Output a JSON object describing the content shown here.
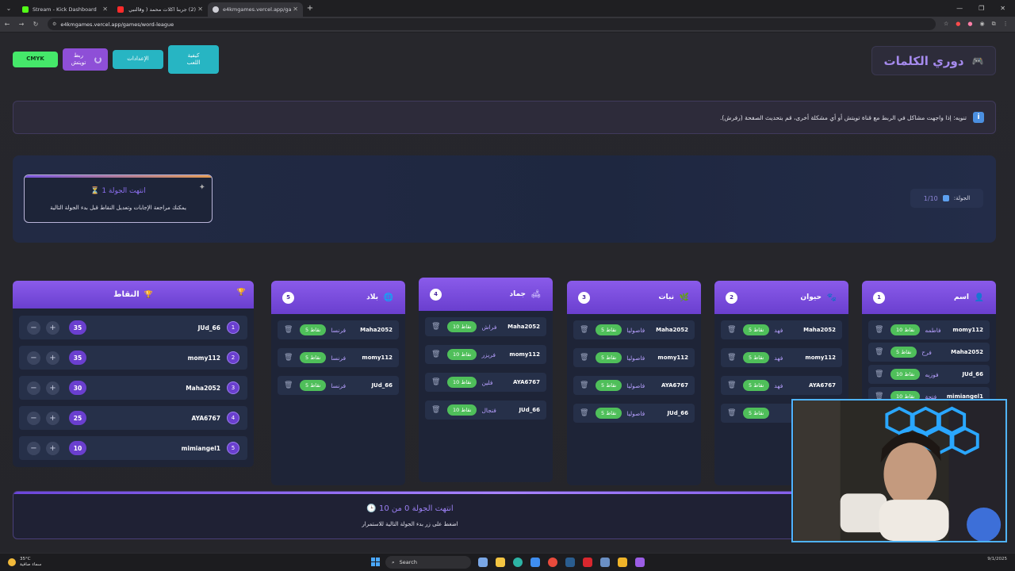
{
  "browser": {
    "tabs": [
      {
        "title": "Stream - Kick Dashboard",
        "fav_color": "#53fc18",
        "active": false
      },
      {
        "title": "(2) جربنا اكلات محمد ( وقالنبي ج...",
        "fav_color": "#ff2b2b",
        "active": false
      },
      {
        "title": "e4kmgames.vercel.app/games/...",
        "fav_color": "#cfcfd6",
        "active": true
      }
    ],
    "url": "e4kmgames.vercel.app/games/word-league"
  },
  "header": {
    "logo_title": "دوري الكلمات",
    "buttons": {
      "cmyk": "CMYK",
      "twitch": "ربط تويتش",
      "settings": "الإعدادات",
      "how_to_play": "كيفية اللعب"
    }
  },
  "notice": {
    "icon": "i",
    "text": "تنويه: إذا واجهت مشاكل في الربط مع قناة تويتش أو أي مشكلة أخرى، قم بتحديث الصفحة (رفرش)."
  },
  "status": {
    "round_ended_title": "انتهت الجولة 1 ⏳",
    "round_ended_sub": "يمكنك مراجعة الإجابات وتعديل النقاط قبل بدء الجولة التالية",
    "round_label": "الجولة:",
    "round_value": "1/10"
  },
  "scores": {
    "title": "النقاط",
    "rows": [
      {
        "rank": "1",
        "player": "JUd_66",
        "score": "35"
      },
      {
        "rank": "2",
        "player": "momy112",
        "score": "35"
      },
      {
        "rank": "3",
        "player": "Maha2052",
        "score": "30"
      },
      {
        "rank": "4",
        "player": "AYA6767",
        "score": "25"
      },
      {
        "rank": "5",
        "player": "mimiangel1",
        "score": "10"
      }
    ]
  },
  "categories": [
    {
      "num": "1",
      "name": "اسم",
      "icon": "person-icon",
      "answers": [
        {
          "user": "momy112",
          "word": "فاطمه",
          "points": "10 نقاط"
        },
        {
          "user": "Maha2052",
          "word": "فرح",
          "points": "5 نقاط"
        },
        {
          "user": "JUd_66",
          "word": "فوزيه",
          "points": "10 نقاط"
        },
        {
          "user": "mimiangel1",
          "word": "فتحة",
          "points": "10 نقاط"
        }
      ]
    },
    {
      "num": "2",
      "name": "حيوان",
      "icon": "paw-icon",
      "answers": [
        {
          "user": "Maha2052",
          "word": "فهد",
          "points": "5 نقاط"
        },
        {
          "user": "momy112",
          "word": "فهد",
          "points": "5 نقاط"
        },
        {
          "user": "AYA6767",
          "word": "فهد",
          "points": "5 نقاط"
        },
        {
          "user": "",
          "word": "",
          "points": "5 نقاط"
        }
      ]
    },
    {
      "num": "3",
      "name": "نبات",
      "icon": "plant-icon",
      "answers": [
        {
          "user": "Maha2052",
          "word": "فاصوليا",
          "points": "5 نقاط"
        },
        {
          "user": "momy112",
          "word": "فاصوليا",
          "points": "5 نقاط"
        },
        {
          "user": "AYA6767",
          "word": "فاصوليا",
          "points": "5 نقاط"
        },
        {
          "user": "JUd_66",
          "word": "فاصوليا",
          "points": "5 نقاط"
        }
      ]
    },
    {
      "num": "4",
      "name": "جماد",
      "icon": "couch-icon",
      "answers": [
        {
          "user": "Maha2052",
          "word": "فراش",
          "points": "10 نقاط"
        },
        {
          "user": "momy112",
          "word": "فريزر",
          "points": "10 نقاط"
        },
        {
          "user": "AYA6767",
          "word": "فلين",
          "points": "10 نقاط"
        },
        {
          "user": "JUd_66",
          "word": "فنجال",
          "points": "10 نقاط"
        }
      ]
    },
    {
      "num": "5",
      "name": "بلاد",
      "icon": "globe-icon",
      "answers": [
        {
          "user": "Maha2052",
          "word": "فرنسا",
          "points": "5 نقاط"
        },
        {
          "user": "momy112",
          "word": "فرنسا",
          "points": "5 نقاط"
        },
        {
          "user": "JUd_66",
          "word": "فرنسا",
          "points": "5 نقاط"
        }
      ]
    }
  ],
  "bottom": {
    "title": "انتهت الجولة 0 من 10 🕒",
    "subtitle": "اضغط على زر بدء الجولة التالية للاستمرار"
  },
  "taskbar": {
    "temp": "35°C",
    "weather": "سماء صافية",
    "search": "Search",
    "date": "9/1/2025"
  }
}
